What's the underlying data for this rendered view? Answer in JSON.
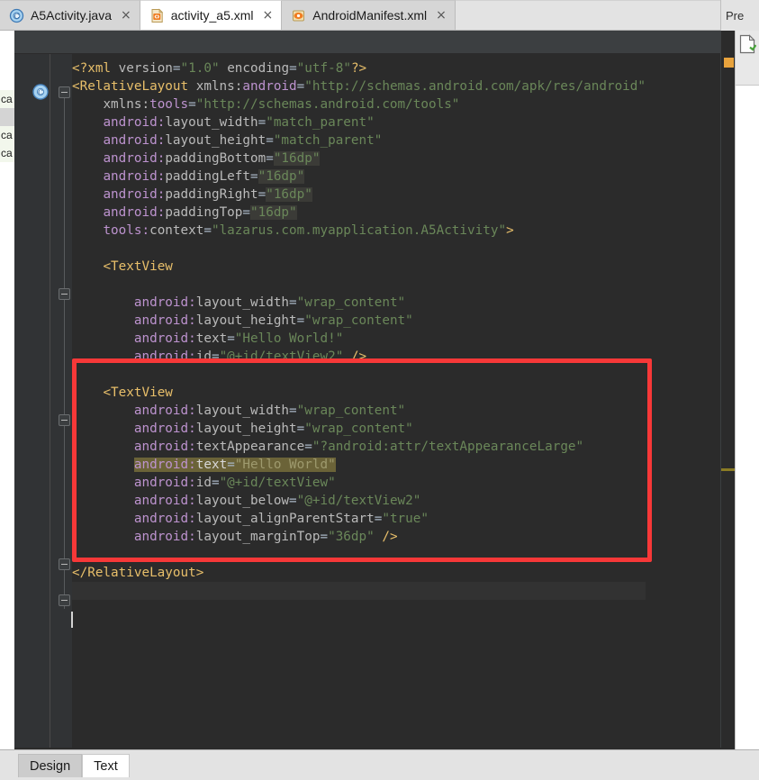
{
  "window": {
    "right_header_label": "Pre"
  },
  "tabs": [
    {
      "label": "A5Activity.java",
      "icon": "java-class-icon",
      "close": "×",
      "active": false
    },
    {
      "label": "activity_a5.xml",
      "icon": "android-xml-icon",
      "close": "×",
      "active": true
    },
    {
      "label": "AndroidManifest.xml",
      "icon": "android-manifest-icon",
      "close": "×",
      "active": false
    }
  ],
  "project_strip": {
    "items": [
      "ca",
      "",
      "ca",
      "ca"
    ]
  },
  "editor": {
    "language": "xml",
    "file": "activity_a5.xml",
    "gutter": {
      "class_marker_icon": "java-class-gutter-icon",
      "class_marker_letter": "C"
    },
    "code_lines": [
      "<?xml version=\"1.0\" encoding=\"utf-8\"?>",
      "<RelativeLayout xmlns:android=\"http://schemas.android.com/apk/res/android\"",
      "    xmlns:tools=\"http://schemas.android.com/tools\"",
      "    android:layout_width=\"match_parent\"",
      "    android:layout_height=\"match_parent\"",
      "    android:paddingBottom=\"16dp\"",
      "    android:paddingLeft=\"16dp\"",
      "    android:paddingRight=\"16dp\"",
      "    android:paddingTop=\"16dp\"",
      "    tools:context=\"lazarus.com.myapplication.A5Activity\">",
      "",
      "    <TextView",
      "",
      "        android:layout_width=\"wrap_content\"",
      "        android:layout_height=\"wrap_content\"",
      "        android:text=\"Hello World!\"",
      "        android:id=\"@+id/textView2\" />",
      "",
      "    <TextView",
      "        android:layout_width=\"wrap_content\"",
      "        android:layout_height=\"wrap_content\"",
      "        android:textAppearance=\"?android:attr/textAppearanceLarge\"",
      "        android:text=\"Hello World\"",
      "        android:id=\"@+id/textView\"",
      "        android:layout_below=\"@+id/textView2\"",
      "        android:layout_alignParentStart=\"true\"",
      "        android:layout_marginTop=\"36dp\" />",
      "",
      "</RelativeLayout>",
      ""
    ],
    "search_highlight_line": "android:text=\"Hello World\"",
    "caret_line_index": 29
  },
  "annotation": {
    "type": "red-rectangle",
    "color": "#f73838",
    "encloses": "second TextView element block"
  },
  "markers": {
    "warning_color": "#e8a33d",
    "find_match_color": "#8a7b24"
  },
  "bottom_tabs": [
    {
      "label": "Design",
      "active": false
    },
    {
      "label": "Text",
      "active": true
    }
  ],
  "colors": {
    "editor_bg": "#2b2b2b",
    "gutter_bg": "#313335",
    "tag": "#e8bf6a",
    "attribute": "#bababa",
    "namespace": "#bd93cf",
    "value": "#6a8759",
    "default_text": "#a9b7c6",
    "find_highlight_bg": "#6b6338",
    "annotation_red": "#f73838"
  }
}
